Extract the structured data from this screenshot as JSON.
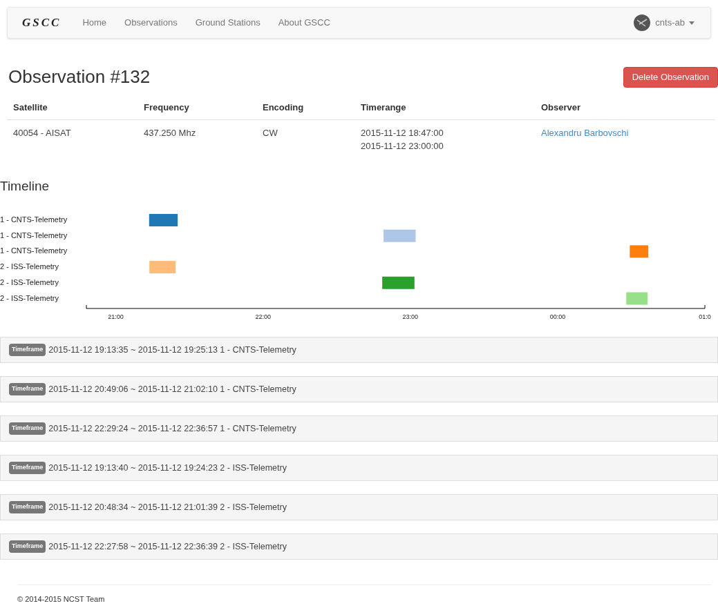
{
  "navbar": {
    "brand": "GSCC",
    "links": [
      {
        "label": "Home"
      },
      {
        "label": "Observations"
      },
      {
        "label": "Ground Stations"
      },
      {
        "label": "About GSCC"
      }
    ],
    "user": "cnts-ab"
  },
  "title": "Observation #132",
  "delete_button": "Delete Observation",
  "table": {
    "columns": [
      "Satellite",
      "Frequency",
      "Encoding",
      "Timerange",
      "Observer"
    ],
    "row": {
      "satellite": "40054 - AISAT",
      "frequency": "437.250 Mhz",
      "encoding": "CW",
      "timerange": [
        "2015-11-12 18:47:00",
        "2015-11-12 23:00:00"
      ],
      "observer": "Alexandru Barbovschi"
    }
  },
  "timeline": {
    "title": "Timeline",
    "chart_data": {
      "type": "bar",
      "orientation": "horizontal",
      "categories": [
        "1 - CNTS-Telemetry",
        "1 - CNTS-Telemetry",
        "1 - CNTS-Telemetry",
        "2 - ISS-Telemetry",
        "2 - ISS-Telemetry",
        "2 - ISS-Telemetry"
      ],
      "bands": [
        {
          "axis": "x",
          "from": 21.226,
          "to": 21.42,
          "color": "#1f77b4"
        },
        {
          "axis": "x",
          "from": 22.818,
          "to": 23.036,
          "color": "#aec7e8"
        },
        {
          "axis": "x",
          "from": 24.49,
          "to": 24.616,
          "color": "#ff7f0e"
        },
        {
          "axis": "x",
          "from": 21.228,
          "to": 21.406,
          "color": "#ffbb78"
        },
        {
          "axis": "x",
          "from": 22.809,
          "to": 23.028,
          "color": "#2ca02c"
        },
        {
          "axis": "x",
          "from": 24.466,
          "to": 24.611,
          "color": "#98df8a"
        }
      ],
      "xlim": [
        20.8,
        25
      ],
      "xticks": [
        {
          "value": 21,
          "label": "21:00"
        },
        {
          "value": 22,
          "label": "22:00"
        },
        {
          "value": 23,
          "label": "23:00"
        },
        {
          "value": 24,
          "label": "00:00"
        },
        {
          "value": 25,
          "label": "01:0"
        }
      ]
    }
  },
  "timeframes": [
    {
      "badge": "Timeframe",
      "text": "2015-11-12 19:13:35 ~ 2015-11-12 19:25:13 1 - CNTS-Telemetry"
    },
    {
      "badge": "Timeframe",
      "text": "2015-11-12 20:49:06 ~ 2015-11-12 21:02:10 1 - CNTS-Telemetry"
    },
    {
      "badge": "Timeframe",
      "text": "2015-11-12 22:29:24 ~ 2015-11-12 22:36:57 1 - CNTS-Telemetry"
    },
    {
      "badge": "Timeframe",
      "text": "2015-11-12 19:13:40 ~ 2015-11-12 19:24:23 2 - ISS-Telemetry"
    },
    {
      "badge": "Timeframe",
      "text": "2015-11-12 20:48:34 ~ 2015-11-12 21:01:39 2 - ISS-Telemetry"
    },
    {
      "badge": "Timeframe",
      "text": "2015-11-12 22:27:58 ~ 2015-11-12 22:36:39 2 - ISS-Telemetry"
    }
  ],
  "footer": "© 2014-2015 NCST Team"
}
